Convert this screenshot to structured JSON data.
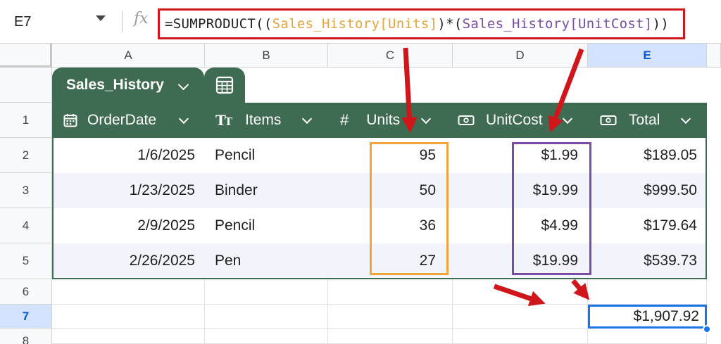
{
  "formula_bar": {
    "name_box": "E7",
    "fx_label": "fx",
    "formula_parts": {
      "p1": "=SUMPRODUCT((",
      "p2": "Sales_History[Units]",
      "p3": ")*(",
      "p4": "Sales_History[UnitCost]",
      "p5": "))"
    }
  },
  "columns": [
    "A",
    "B",
    "C",
    "D",
    "E"
  ],
  "rows": [
    "1",
    "2",
    "3",
    "4",
    "5",
    "6",
    "7",
    "8"
  ],
  "selected_column": "E",
  "selected_row": "7",
  "table": {
    "name": "Sales_History",
    "headers": {
      "order_date": "OrderDate",
      "items": "Items",
      "units": "Units",
      "unit_cost": "UnitCost",
      "total": "Total"
    },
    "header_icons": {
      "order_date": "calendar-icon",
      "items": "text-type-icon",
      "units": "number-sign-icon",
      "unit_cost": "currency-icon",
      "total": "currency-icon"
    },
    "rows": [
      {
        "order_date": "1/6/2025",
        "item": "Pencil",
        "units": "95",
        "unit_cost": "$1.99",
        "total": "$189.05"
      },
      {
        "order_date": "1/23/2025",
        "item": "Binder",
        "units": "50",
        "unit_cost": "$19.99",
        "total": "$999.50"
      },
      {
        "order_date": "2/9/2025",
        "item": "Pencil",
        "units": "36",
        "unit_cost": "$4.99",
        "total": "$179.64"
      },
      {
        "order_date": "2/26/2025",
        "item": "Pen",
        "units": "27",
        "unit_cost": "$19.99",
        "total": "$539.73"
      }
    ]
  },
  "result_cell": {
    "address": "E7",
    "value": "$1,907.92"
  },
  "colors": {
    "table_header": "#3f6b52",
    "formula_border": "#d0161b",
    "units_highlight": "#f0a63a",
    "unitcost_highlight": "#7b4ca6",
    "active_cell": "#1a73e8",
    "annotation_arrow": "#d0161b"
  }
}
